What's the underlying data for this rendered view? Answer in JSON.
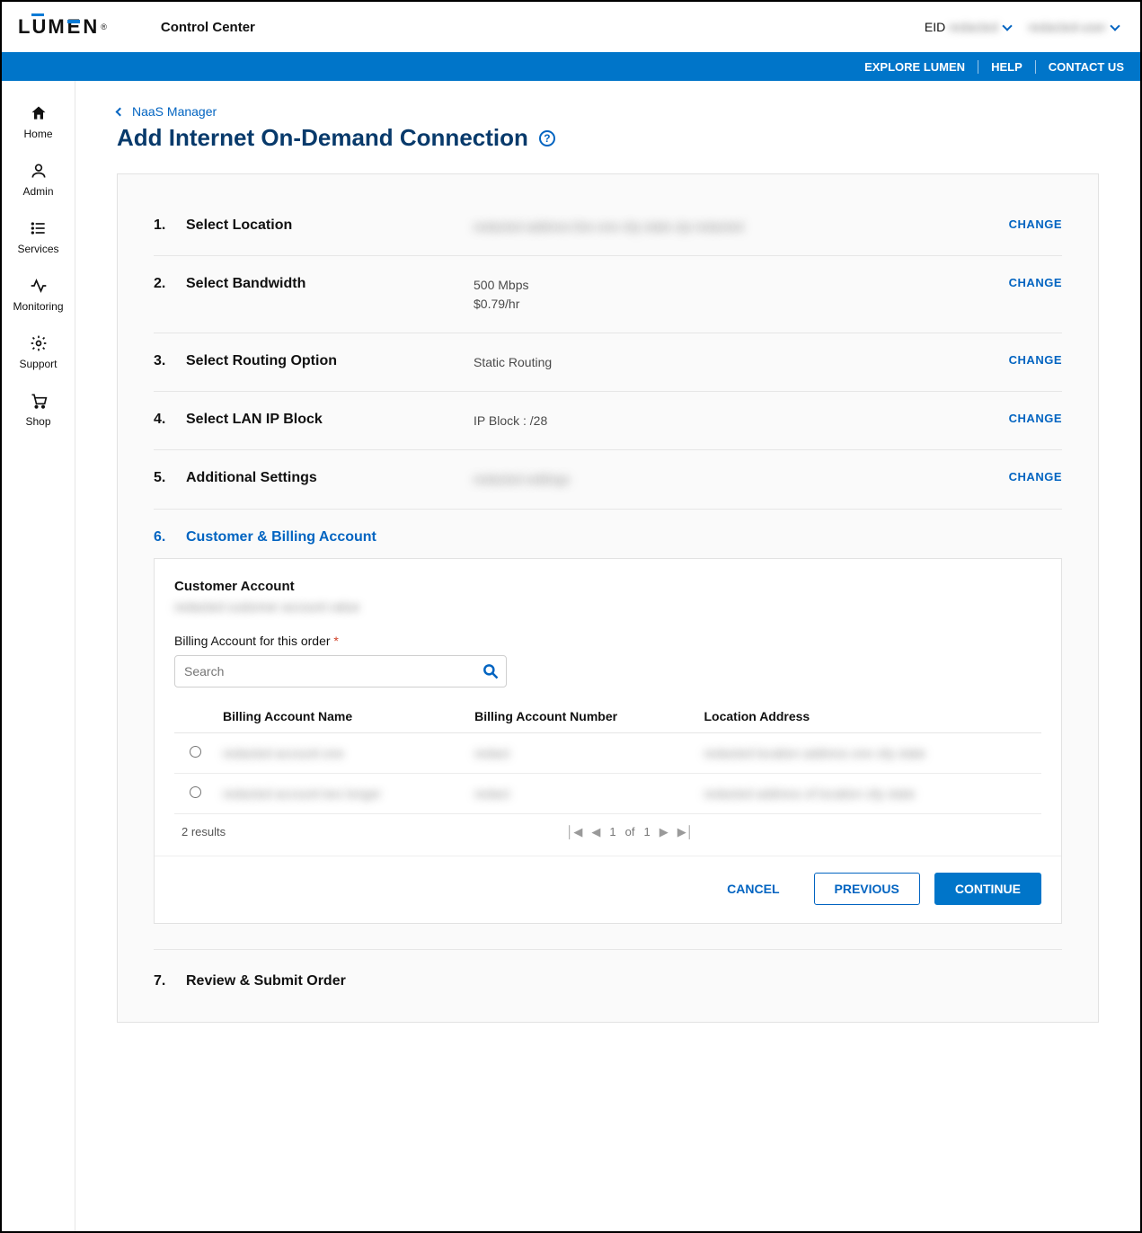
{
  "header": {
    "brand": "LUMEN",
    "app_title": "Control Center",
    "eid_label": "EID",
    "eid_value": "redacted",
    "user_value": "redacted-user"
  },
  "blue_strip": {
    "explore": "EXPLORE LUMEN",
    "help": "HELP",
    "contact": "CONTACT US"
  },
  "sidebar": {
    "items": [
      {
        "label": "Home"
      },
      {
        "label": "Admin"
      },
      {
        "label": "Services"
      },
      {
        "label": "Monitoring"
      },
      {
        "label": "Support"
      },
      {
        "label": "Shop"
      }
    ]
  },
  "breadcrumb": "NaaS Manager",
  "page_title": "Add Internet On-Demand Connection",
  "steps": [
    {
      "num": "1.",
      "title": "Select Location",
      "value": "redacted address line one city state zip redacted",
      "change": "CHANGE"
    },
    {
      "num": "2.",
      "title": "Select Bandwidth",
      "value_line1": "500 Mbps",
      "value_line2": "$0.79/hr",
      "change": "CHANGE"
    },
    {
      "num": "3.",
      "title": "Select Routing Option",
      "value": "Static Routing",
      "change": "CHANGE"
    },
    {
      "num": "4.",
      "title": "Select LAN IP Block",
      "value": "IP Block : /28",
      "change": "CHANGE"
    },
    {
      "num": "5.",
      "title": "Additional Settings",
      "value": "redacted settings",
      "change": "CHANGE"
    }
  ],
  "active_step": {
    "num": "6.",
    "title": "Customer & Billing Account"
  },
  "card": {
    "customer_account_label": "Customer Account",
    "customer_account_value": "redacted customer account value",
    "billing_label": "Billing Account for this order",
    "search_placeholder": "Search",
    "columns": {
      "name": "Billing Account Name",
      "number": "Billing Account Number",
      "address": "Location Address"
    },
    "rows": [
      {
        "name": "redacted account one",
        "number": "redact",
        "address": "redacted location address one city state"
      },
      {
        "name": "redacted account two longer",
        "number": "redact",
        "address": "redacted address of location city state"
      }
    ],
    "results_text": "2 results",
    "pager": {
      "page": "1",
      "of_label": "of",
      "total": "1"
    },
    "actions": {
      "cancel": "CANCEL",
      "previous": "PREVIOUS",
      "continue": "CONTINUE"
    }
  },
  "final_step": {
    "num": "7.",
    "title": "Review & Submit Order"
  }
}
